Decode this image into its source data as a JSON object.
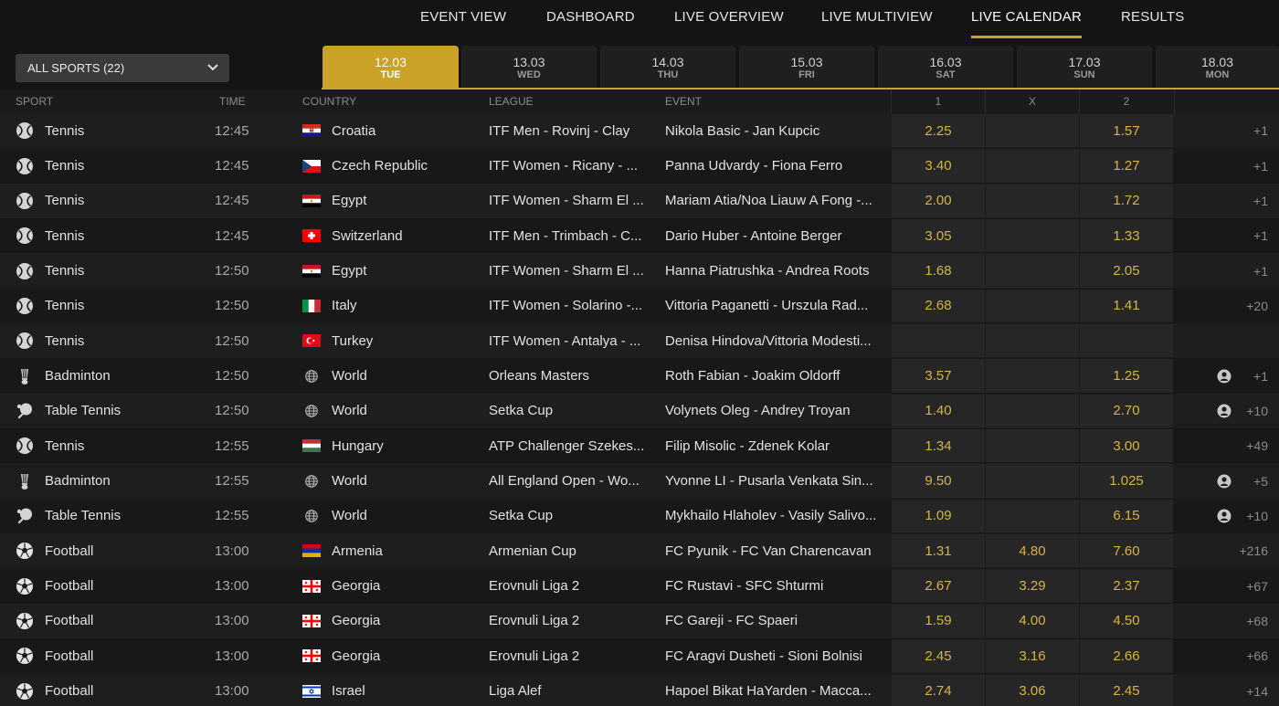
{
  "nav": [
    {
      "label": "EVENT VIEW",
      "active": false
    },
    {
      "label": "DASHBOARD",
      "active": false
    },
    {
      "label": "LIVE OVERVIEW",
      "active": false
    },
    {
      "label": "LIVE MULTIVIEW",
      "active": false
    },
    {
      "label": "LIVE CALENDAR",
      "active": true
    },
    {
      "label": "RESULTS",
      "active": false
    }
  ],
  "sport_select": {
    "label": "ALL SPORTS (22)"
  },
  "dates": [
    {
      "date": "12.03",
      "day": "TUE",
      "active": true
    },
    {
      "date": "13.03",
      "day": "WED",
      "active": false
    },
    {
      "date": "14.03",
      "day": "THU",
      "active": false
    },
    {
      "date": "15.03",
      "day": "FRI",
      "active": false
    },
    {
      "date": "16.03",
      "day": "SAT",
      "active": false
    },
    {
      "date": "17.03",
      "day": "SUN",
      "active": false
    },
    {
      "date": "18.03",
      "day": "MON",
      "active": false
    }
  ],
  "columns": {
    "sport": "SPORT",
    "time": "TIME",
    "country": "COUNTRY",
    "league": "LEAGUE",
    "event": "EVENT",
    "one": "1",
    "x": "X",
    "two": "2"
  },
  "colors": {
    "accent": "#c9a227",
    "odds": "#d8b340",
    "background": "#141414"
  },
  "rows": [
    {
      "sport": "Tennis",
      "sport_icon": "tennis-icon",
      "time": "12:45",
      "country": "Croatia",
      "flag": "croatia",
      "league": "ITF Men - Rovinj - Clay",
      "event": "Nikola Basic - Jan Kupcic",
      "odd1": "2.25",
      "oddx": "",
      "odd2": "1.57",
      "more": "+1",
      "stream": false
    },
    {
      "sport": "Tennis",
      "sport_icon": "tennis-icon",
      "time": "12:45",
      "country": "Czech Republic",
      "flag": "czech",
      "league": "ITF Women - Ricany - ...",
      "event": "Panna Udvardy - Fiona Ferro",
      "odd1": "3.40",
      "oddx": "",
      "odd2": "1.27",
      "more": "+1",
      "stream": false
    },
    {
      "sport": "Tennis",
      "sport_icon": "tennis-icon",
      "time": "12:45",
      "country": "Egypt",
      "flag": "egypt",
      "league": "ITF Women - Sharm El ...",
      "event": "Mariam Atia/Noa Liauw A Fong -...",
      "odd1": "2.00",
      "oddx": "",
      "odd2": "1.72",
      "more": "+1",
      "stream": false
    },
    {
      "sport": "Tennis",
      "sport_icon": "tennis-icon",
      "time": "12:45",
      "country": "Switzerland",
      "flag": "switzerland",
      "league": "ITF Men - Trimbach - C...",
      "event": "Dario Huber - Antoine Berger",
      "odd1": "3.05",
      "oddx": "",
      "odd2": "1.33",
      "more": "+1",
      "stream": false
    },
    {
      "sport": "Tennis",
      "sport_icon": "tennis-icon",
      "time": "12:50",
      "country": "Egypt",
      "flag": "egypt",
      "league": "ITF Women - Sharm El ...",
      "event": "Hanna Piatrushka - Andrea Roots",
      "odd1": "1.68",
      "oddx": "",
      "odd2": "2.05",
      "more": "+1",
      "stream": false
    },
    {
      "sport": "Tennis",
      "sport_icon": "tennis-icon",
      "time": "12:50",
      "country": "Italy",
      "flag": "italy",
      "league": "ITF Women - Solarino -...",
      "event": "Vittoria Paganetti - Urszula Rad...",
      "odd1": "2.68",
      "oddx": "",
      "odd2": "1.41",
      "more": "+20",
      "stream": false
    },
    {
      "sport": "Tennis",
      "sport_icon": "tennis-icon",
      "time": "12:50",
      "country": "Turkey",
      "flag": "turkey",
      "league": "ITF Women - Antalya - ...",
      "event": "Denisa Hindova/Vittoria Modesti...",
      "odd1": "",
      "oddx": "",
      "odd2": "",
      "more": "",
      "stream": false
    },
    {
      "sport": "Badminton",
      "sport_icon": "shuttlecock-icon",
      "time": "12:50",
      "country": "World",
      "flag": "world",
      "league": "Orleans Masters",
      "event": "Roth Fabian - Joakim Oldorff",
      "odd1": "3.57",
      "oddx": "",
      "odd2": "1.25",
      "more": "+1",
      "stream": true
    },
    {
      "sport": "Table Tennis",
      "sport_icon": "ping-pong-icon",
      "time": "12:50",
      "country": "World",
      "flag": "world",
      "league": "Setka Cup",
      "event": "Volynets Oleg - Andrey Troyan",
      "odd1": "1.40",
      "oddx": "",
      "odd2": "2.70",
      "more": "+10",
      "stream": true
    },
    {
      "sport": "Tennis",
      "sport_icon": "tennis-icon",
      "time": "12:55",
      "country": "Hungary",
      "flag": "hungary",
      "league": "ATP Challenger Szekes...",
      "event": "Filip Misolic - Zdenek Kolar",
      "odd1": "1.34",
      "oddx": "",
      "odd2": "3.00",
      "more": "+49",
      "stream": false
    },
    {
      "sport": "Badminton",
      "sport_icon": "shuttlecock-icon",
      "time": "12:55",
      "country": "World",
      "flag": "world",
      "league": "All England Open - Wo...",
      "event": "Yvonne LI - Pusarla Venkata Sin...",
      "odd1": "9.50",
      "oddx": "",
      "odd2": "1.025",
      "more": "+5",
      "stream": true
    },
    {
      "sport": "Table Tennis",
      "sport_icon": "ping-pong-icon",
      "time": "12:55",
      "country": "World",
      "flag": "world",
      "league": "Setka Cup",
      "event": "Mykhailo Hlaholev - Vasily Salivo...",
      "odd1": "1.09",
      "oddx": "",
      "odd2": "6.15",
      "more": "+10",
      "stream": true
    },
    {
      "sport": "Football",
      "sport_icon": "soccer-ball-icon",
      "time": "13:00",
      "country": "Armenia",
      "flag": "armenia",
      "league": "Armenian Cup",
      "event": "FC Pyunik - FC Van Charencavan",
      "odd1": "1.31",
      "oddx": "4.80",
      "odd2": "7.60",
      "more": "+216",
      "stream": false
    },
    {
      "sport": "Football",
      "sport_icon": "soccer-ball-icon",
      "time": "13:00",
      "country": "Georgia",
      "flag": "georgia",
      "league": "Erovnuli Liga 2",
      "event": "FC Rustavi - SFC Shturmi",
      "odd1": "2.67",
      "oddx": "3.29",
      "odd2": "2.37",
      "more": "+67",
      "stream": false
    },
    {
      "sport": "Football",
      "sport_icon": "soccer-ball-icon",
      "time": "13:00",
      "country": "Georgia",
      "flag": "georgia",
      "league": "Erovnuli Liga 2",
      "event": "FC Gareji - FC Spaeri",
      "odd1": "1.59",
      "oddx": "4.00",
      "odd2": "4.50",
      "more": "+68",
      "stream": false
    },
    {
      "sport": "Football",
      "sport_icon": "soccer-ball-icon",
      "time": "13:00",
      "country": "Georgia",
      "flag": "georgia",
      "league": "Erovnuli Liga 2",
      "event": "FC Aragvi Dusheti - Sioni Bolnisi",
      "odd1": "2.45",
      "oddx": "3.16",
      "odd2": "2.66",
      "more": "+66",
      "stream": false
    },
    {
      "sport": "Football",
      "sport_icon": "soccer-ball-icon",
      "time": "13:00",
      "country": "Israel",
      "flag": "israel",
      "league": "Liga Alef",
      "event": "Hapoel Bikat HaYarden - Macca...",
      "odd1": "2.74",
      "oddx": "3.06",
      "odd2": "2.45",
      "more": "+14",
      "stream": false
    }
  ]
}
